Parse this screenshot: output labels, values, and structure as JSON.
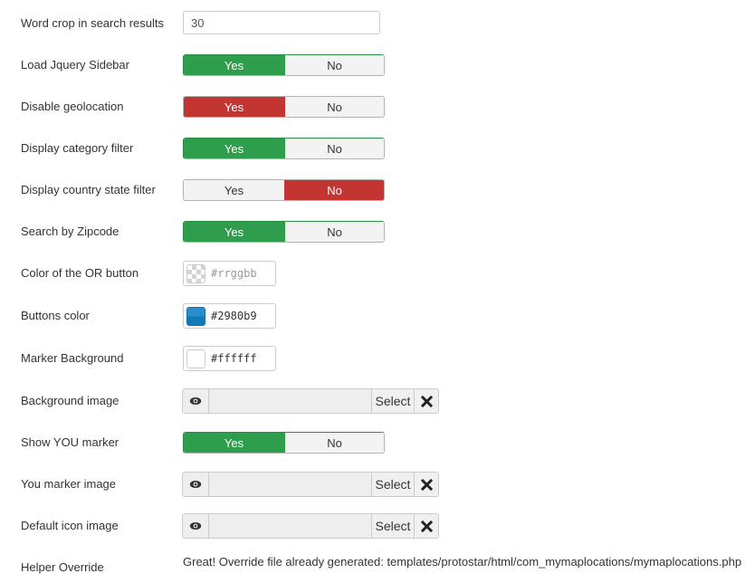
{
  "fields": {
    "word_crop": {
      "label": "Word crop in search results",
      "value": "30"
    },
    "load_jquery_sidebar": {
      "label": "Load Jquery Sidebar",
      "yes": "Yes",
      "no": "No",
      "selected": "Yes"
    },
    "disable_geolocation": {
      "label": "Disable geolocation",
      "yes": "Yes",
      "no": "No",
      "selected": "Yes"
    },
    "display_category_filter": {
      "label": "Display category filter",
      "yes": "Yes",
      "no": "No",
      "selected": "Yes"
    },
    "display_country_state_filter": {
      "label": "Display country state filter",
      "yes": "Yes",
      "no": "No",
      "selected": "No"
    },
    "search_by_zipcode": {
      "label": "Search by Zipcode",
      "yes": "Yes",
      "no": "No",
      "selected": "Yes"
    },
    "or_button_color": {
      "label": "Color of the OR button",
      "value": "",
      "placeholder": "#rrggbb"
    },
    "buttons_color": {
      "label": "Buttons color",
      "value": "#2980b9",
      "swatch": "#1a84c4"
    },
    "marker_background": {
      "label": "Marker Background",
      "value": "#ffffff",
      "swatch": "#ffffff"
    },
    "background_image": {
      "label": "Background image",
      "value": "",
      "select_label": "Select"
    },
    "show_you_marker": {
      "label": "Show YOU marker",
      "yes": "Yes",
      "no": "No",
      "selected": "Yes"
    },
    "you_marker_image": {
      "label": "You marker image",
      "value": "",
      "select_label": "Select"
    },
    "default_icon_image": {
      "label": "Default icon image",
      "value": "",
      "select_label": "Select"
    },
    "helper_override": {
      "label": "Helper Override",
      "message": "Great! Override file already generated: templates/protostar/html/com_mymaplocations/mymaplocations.php"
    }
  },
  "colors": {
    "yes_active": "#2f9e4c",
    "danger_active": "#c33531"
  },
  "icons": {
    "preview": "eye-icon",
    "clear": "close-icon"
  }
}
